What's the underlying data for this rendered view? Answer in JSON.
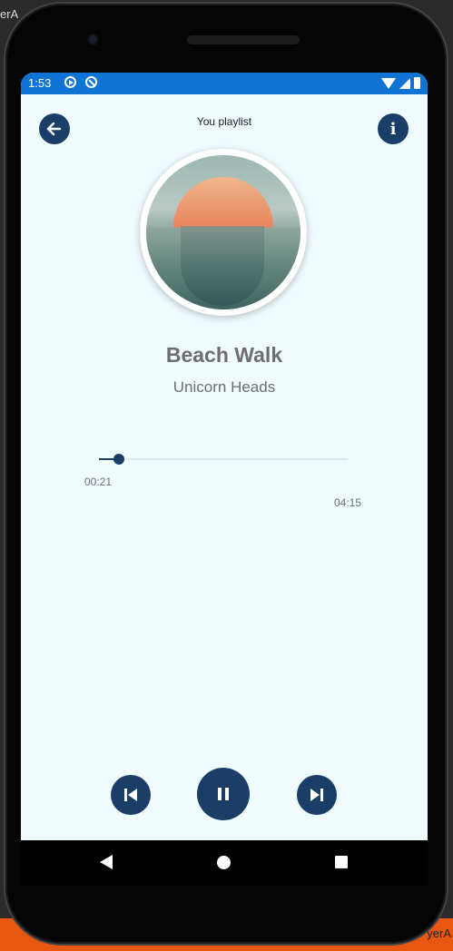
{
  "host": {
    "left_text": "erA",
    "right_text": "yerA"
  },
  "status_bar": {
    "time": "1:53",
    "icons": [
      "media-play-icon",
      "sync-off-icon",
      "wifi-icon",
      "signal-icon",
      "battery-icon"
    ]
  },
  "header": {
    "title": "You playlist",
    "back_icon": "arrow-left-icon",
    "info_icon": "info-icon",
    "info_glyph": "i"
  },
  "track": {
    "title": "Beach Walk",
    "artist": "Unicorn Heads",
    "elapsed": "00:21",
    "duration": "04:15",
    "progress_fraction": 0.08
  },
  "controls": {
    "previous_icon": "skip-previous-icon",
    "play_pause_icon": "pause-icon",
    "next_icon": "skip-next-icon"
  },
  "nav_bar": {
    "icons": [
      "back-triangle-icon",
      "home-circle-icon",
      "recents-square-icon"
    ]
  },
  "colors": {
    "status_bar": "#0f74d4",
    "accent": "#1b3e68",
    "screen_bg": "#f0fbff",
    "text_muted": "#6e6e6e"
  }
}
